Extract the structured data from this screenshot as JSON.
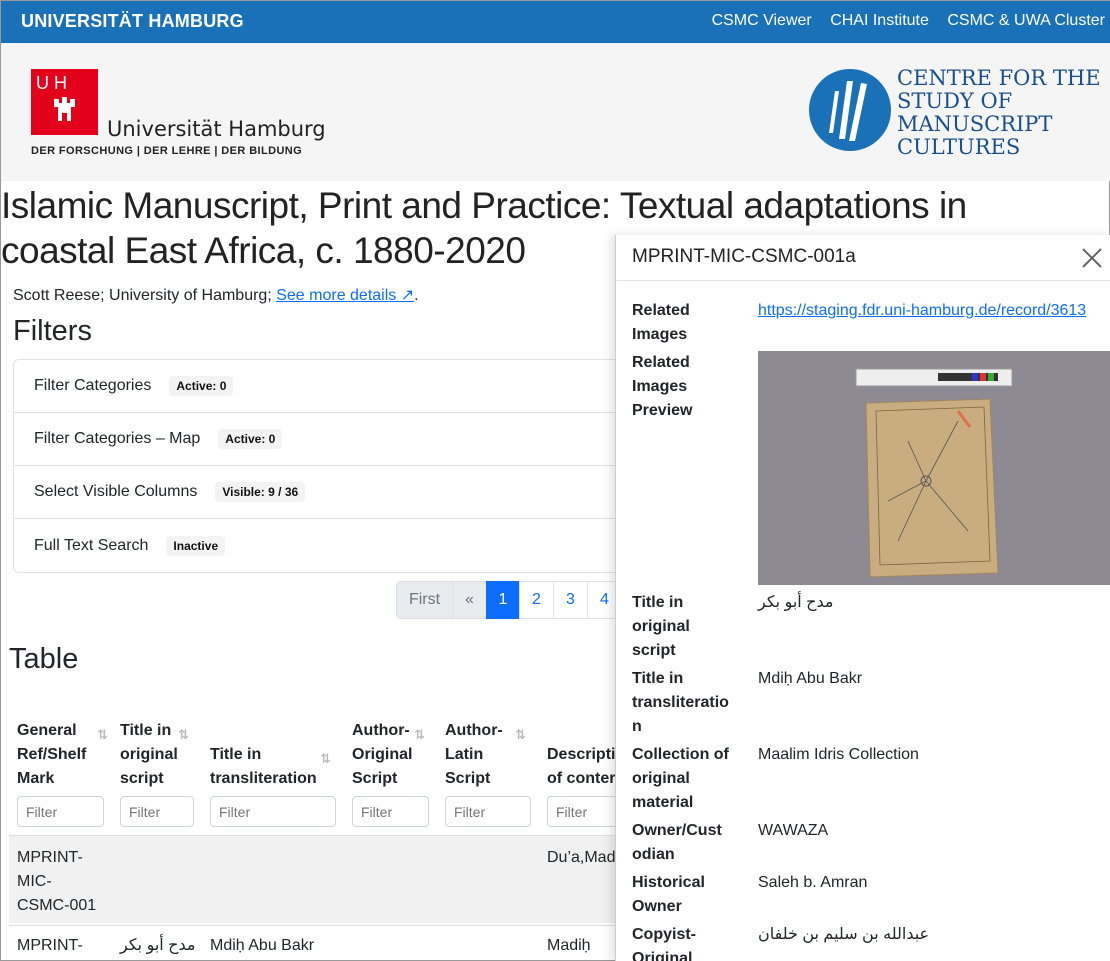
{
  "topbar": {
    "brand": "UNIVERSITÄT HAMBURG",
    "links": [
      "CSMC Viewer",
      "CHAI Institute",
      "CSMC & UWA Cluster"
    ]
  },
  "header": {
    "uhh_logo_text": "U H",
    "uhh_name": "Universität Hamburg",
    "uhh_sub": "DER FORSCHUNG | DER LEHRE | DER BILDUNG",
    "csmc_lines": [
      "CENTRE FOR THE",
      "STUDY OF",
      "MANUSCRIPT",
      "CULTURES"
    ]
  },
  "page": {
    "title_line1": "Islamic Manuscript, Print and Practice: Textual adaptations in",
    "title_line2": "coastal East Africa, c. 1880-2020",
    "credits": "Scott Reese; University of Hamburg;",
    "details_link": "See more details ↗",
    "details_after": "."
  },
  "filters": {
    "heading": "Filters",
    "rows": [
      {
        "label": "Filter Categories",
        "badge": "Active: 0"
      },
      {
        "label": "Filter Categories – Map",
        "badge": "Active: 0"
      },
      {
        "label": "Select Visible Columns",
        "badge": "Visible: 9 / 36"
      },
      {
        "label": "Full Text Search",
        "badge": "Inactive"
      }
    ]
  },
  "pagination": {
    "first": "First",
    "prev": "«",
    "pages": [
      "1",
      "2",
      "3",
      "4"
    ]
  },
  "table": {
    "heading": "Table",
    "columns": [
      {
        "l1": "General",
        "l2": "Ref/Shelf",
        "l3": "Mark"
      },
      {
        "l1": "Title in",
        "l2": "original",
        "l3": "script"
      },
      {
        "l1": "",
        "l2": "Title in",
        "l3": "transliteration"
      },
      {
        "l1": "Author-",
        "l2": "Original",
        "l3": "Script"
      },
      {
        "l1": "Author-",
        "l2": "Latin",
        "l3": "Script"
      },
      {
        "l1": "",
        "l2": "Descripti",
        "l3": "of conter"
      }
    ],
    "filter_placeholder": "Filter",
    "rows": [
      {
        "ref": [
          "MPRINT-",
          "MIC-",
          "CSMC-001"
        ],
        "orig": "",
        "translit": "",
        "author_orig": "",
        "author_latin": "",
        "desc": "Du’a,Mad"
      },
      {
        "ref": [
          "MPRINT-"
        ],
        "orig": "مدح أبو بكر",
        "translit": "Mdiḥ Abu Bakr",
        "author_orig": "",
        "author_latin": "",
        "desc": "Madiḥ"
      }
    ]
  },
  "panel": {
    "title": "MPRINT-MIC-CSMC-001a",
    "fields": [
      {
        "label": [
          "Related",
          "Images"
        ],
        "value": "https://staging.fdr.uni-hamburg.de/record/3613",
        "is_link": true
      },
      {
        "label": [
          "Related",
          "Images",
          "Preview"
        ],
        "value": ""
      },
      {
        "label": [
          "Title in",
          "original",
          "script"
        ],
        "value": "مدح أبو بكر"
      },
      {
        "label": [
          "Title in",
          "transliteratio",
          "n"
        ],
        "value": "Mdiḥ Abu Bakr"
      },
      {
        "label": [
          "Collection of",
          "original",
          "material"
        ],
        "value": "Maalim Idris Collection"
      },
      {
        "label": [
          "Owner/Cust",
          "odian"
        ],
        "value": "WAWAZA"
      },
      {
        "label": [
          "Historical",
          "Owner"
        ],
        "value": "Saleh b. Amran"
      },
      {
        "label": [
          "Copyist-",
          "Original"
        ],
        "value": "عبدالله بن سليم بن خلفان"
      }
    ]
  },
  "colors": {
    "topbar": "#1b71b7",
    "uhh_red": "#e2001a",
    "csmc_blue": "#1b4f8c",
    "link": "#0d6efd"
  }
}
